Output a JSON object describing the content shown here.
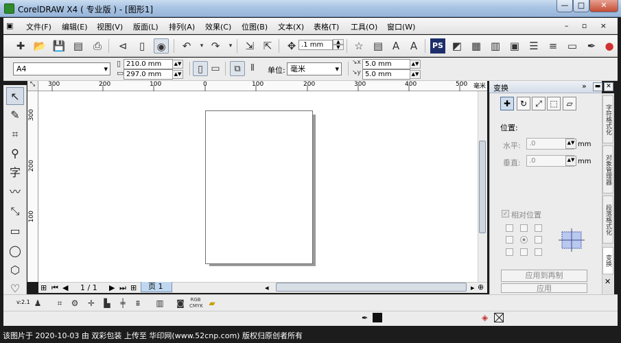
{
  "title": "CorelDRAW X4 ( 专业版 ) - [图形1]",
  "window_buttons": {
    "minimize": "—",
    "maximize": "□",
    "close": "✕"
  },
  "menu": [
    "文件(F)",
    "编辑(E)",
    "视图(V)",
    "版面(L)",
    "排列(A)",
    "效果(C)",
    "位图(B)",
    "文本(X)",
    "表格(T)",
    "工具(O)",
    "窗口(W)"
  ],
  "doc_controls": "– ▫ ×",
  "toolbar": {
    "nudge_value": ".1 mm"
  },
  "property_bar": {
    "paper_size": "A4",
    "width": "210.0 mm",
    "height": "297.0 mm",
    "units_label": "单位:",
    "units_value": "毫米",
    "dup_x": "5.0 mm",
    "dup_y": "5.0 mm"
  },
  "ruler": {
    "h_ticks": [
      "300",
      "200",
      "100",
      "0",
      "100",
      "200",
      "300",
      "400",
      "500"
    ],
    "h_unit": "毫米",
    "v_ticks": [
      "300",
      "200",
      "100"
    ]
  },
  "page_nav": {
    "counter": "1 / 1",
    "tab_label": "页 1"
  },
  "docker": {
    "title": "变换",
    "position_label": "位置:",
    "horizontal_label": "水平:",
    "horizontal_value": ".0",
    "vertical_label": "垂直:",
    "vertical_value": ".0",
    "unit_h": "mm",
    "unit_v": "mm",
    "relative_label": "相对位置",
    "apply_copy_label": "应用到再制",
    "apply_label": "应用"
  },
  "side_tabs": [
    "字符格式化",
    "对象管理器",
    "段落格式化",
    "变换"
  ],
  "status": {
    "version": "v:2.1"
  },
  "caption": "该图片于 2020-10-03 由 双彩包装 上传至 华印网(www.52cnp.com) 版权归原创者所有",
  "colors": {
    "titlebar": "#a9c4e3",
    "page_tab": "#c0d8ef",
    "docker_header": "#d3dce8"
  },
  "icons": [
    "new-icon",
    "open-icon",
    "save-icon",
    "print-icon",
    "undo-icon",
    "redo-icon",
    "import-icon",
    "export-icon",
    "star-icon",
    "pick-tool-icon",
    "shape-tool-icon",
    "crop-tool-icon",
    "zoom-tool-icon",
    "text-tool-icon",
    "rectangle-tool-icon",
    "ellipse-tool-icon",
    "polygon-tool-icon",
    "fill-swatch-icon",
    "outline-icon"
  ]
}
